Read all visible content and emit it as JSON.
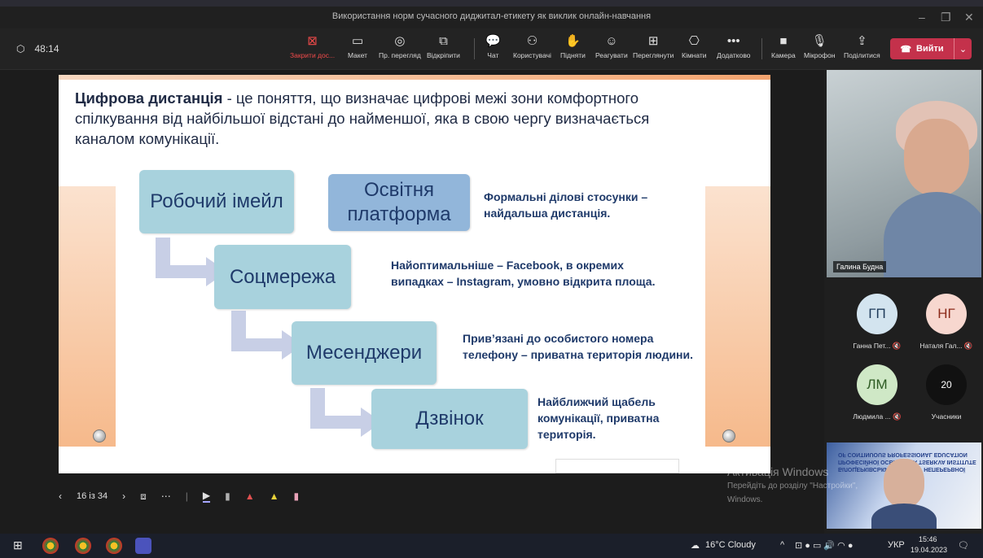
{
  "window": {
    "title": "Використання норм сучасного диджитал-етикету як виклик онлайн-навчання"
  },
  "toolbar": {
    "timer": "48:14",
    "buttons": [
      {
        "icon": "stop-share-icon",
        "label": "Закрити дос..."
      },
      {
        "icon": "layout-icon",
        "label": "Макет"
      },
      {
        "icon": "presenter-view-icon",
        "label": "Пр. перегляд"
      },
      {
        "icon": "popout-icon",
        "label": "Відкріпити"
      },
      {
        "icon": "chat-icon",
        "label": "Чат"
      },
      {
        "icon": "people-icon",
        "label": "Користувачі"
      },
      {
        "icon": "raise-hand-icon",
        "label": "Підняти"
      },
      {
        "icon": "react-icon",
        "label": "Реагувати"
      },
      {
        "icon": "view-icon",
        "label": "Переглянути"
      },
      {
        "icon": "rooms-icon",
        "label": "Кімнати"
      },
      {
        "icon": "more-icon",
        "label": "Додатково"
      },
      {
        "icon": "camera-icon",
        "label": "Камера"
      },
      {
        "icon": "mic-icon",
        "label": "Мікрофон"
      },
      {
        "icon": "share-icon",
        "label": "Поділитися"
      }
    ],
    "leave_label": "Вийти"
  },
  "slide": {
    "definition_term": "Цифрова дистанція",
    "definition_text": " - це поняття, що визначає цифрові межі зони комфортного спілкування від найбільшої відстані до найменшої, яка в свою чергу визначається каналом комунікації.",
    "boxes": [
      "Робочий імейл",
      "Освітня платформа",
      "Соцмережа",
      "Месенджери",
      "Дзвінок"
    ],
    "notes": [
      "Формальні ділові стосунки – найдальша дистанція.",
      "Найоптимальніше – Facebook, в окремих випадках – Instagram,  умовно відкрита площа.",
      "Прив’язані до особистого номера телефону – приватна територія людини.",
      "Найближчий щабель комунікації, приватна територія."
    ],
    "counter": "16 із 34"
  },
  "participants": {
    "main_video_name": "Галина Будна",
    "tiles": [
      {
        "initials": "ГП",
        "name": "Ганна Пет...",
        "bg": "#d3e4ef",
        "fg": "#1f3b5a"
      },
      {
        "initials": "НГ",
        "name": "Наталя Гал...",
        "bg": "#f7d7cf",
        "fg": "#8b2a1a"
      },
      {
        "initials": "ЛМ",
        "name": "Людмила ...",
        "bg": "#cfe8c6",
        "fg": "#2c5a22"
      },
      {
        "initials": "20",
        "name": "Учасники",
        "bg": "#111111",
        "fg": "#ffffff"
      }
    ],
    "banner_text": "БІЛОЦЕРКІВСЬКИЙ ІНСТИТУТ НЕПЕРЕРВНОЇ ПРОФЕСІЙНОЇ ОСВІТИ BILA TSERKVA INSTITUTE OF CONTINUOUS PROFESSIONAL EDUCATION"
  },
  "activation": {
    "title": "Активація Windows",
    "line1": "Перейдіть до розділу \"Настройки\",",
    "line2": "Windows."
  },
  "taskbar": {
    "weather": "16°C  Cloudy",
    "lang": "УКР",
    "time": "15:46",
    "date": "19.04.2023"
  }
}
